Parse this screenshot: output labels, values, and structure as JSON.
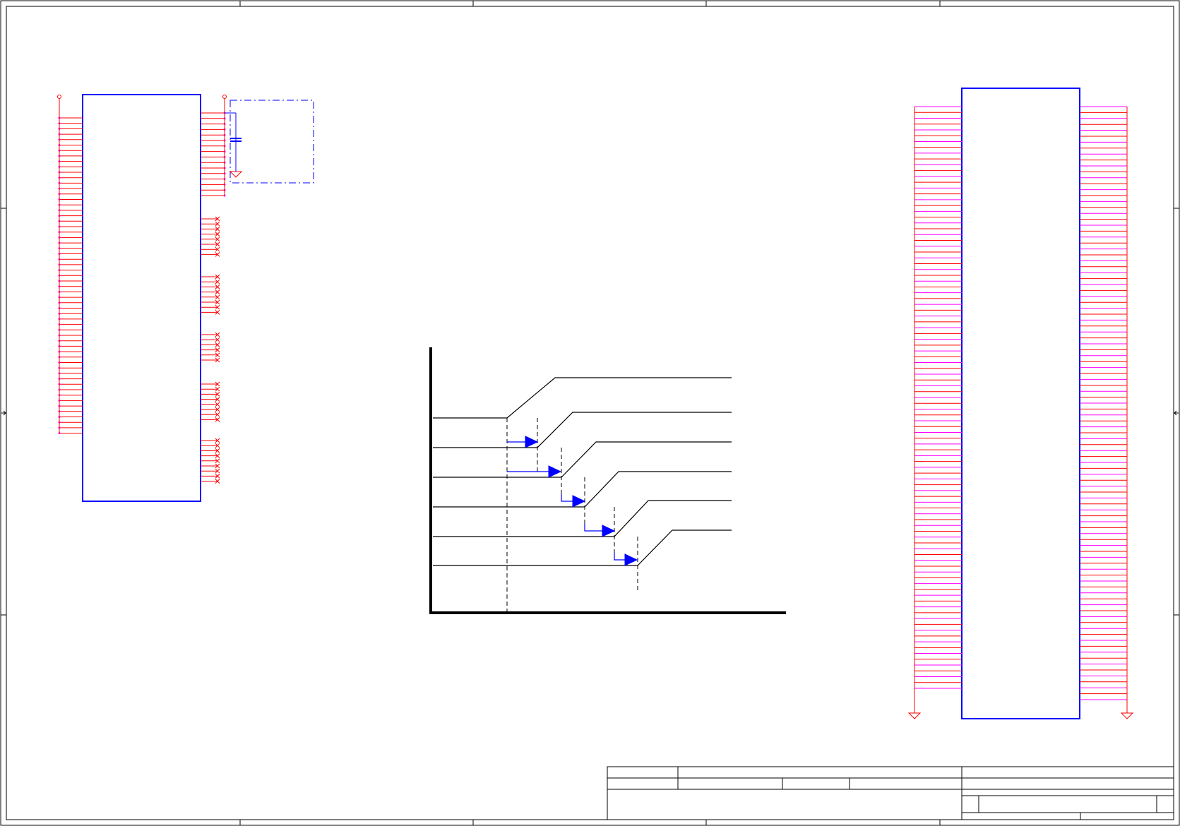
{
  "schematic": {
    "colors": {
      "frame": "#000000",
      "symbol_body": "#0000ff",
      "wire": "#ff0000",
      "junction": "#ff00ff",
      "sequence_line": "#000000",
      "sequence_arrow": "#0000ff"
    },
    "left_connector": {
      "left_pins": 59,
      "right_pins_used": 16,
      "no_connect_groups": [
        8,
        8,
        6,
        8,
        9
      ]
    },
    "right_connector": {
      "left_pins": 101,
      "right_pins": 101
    },
    "power_sequence": {
      "rails": 6,
      "step_arrows": 5
    }
  }
}
